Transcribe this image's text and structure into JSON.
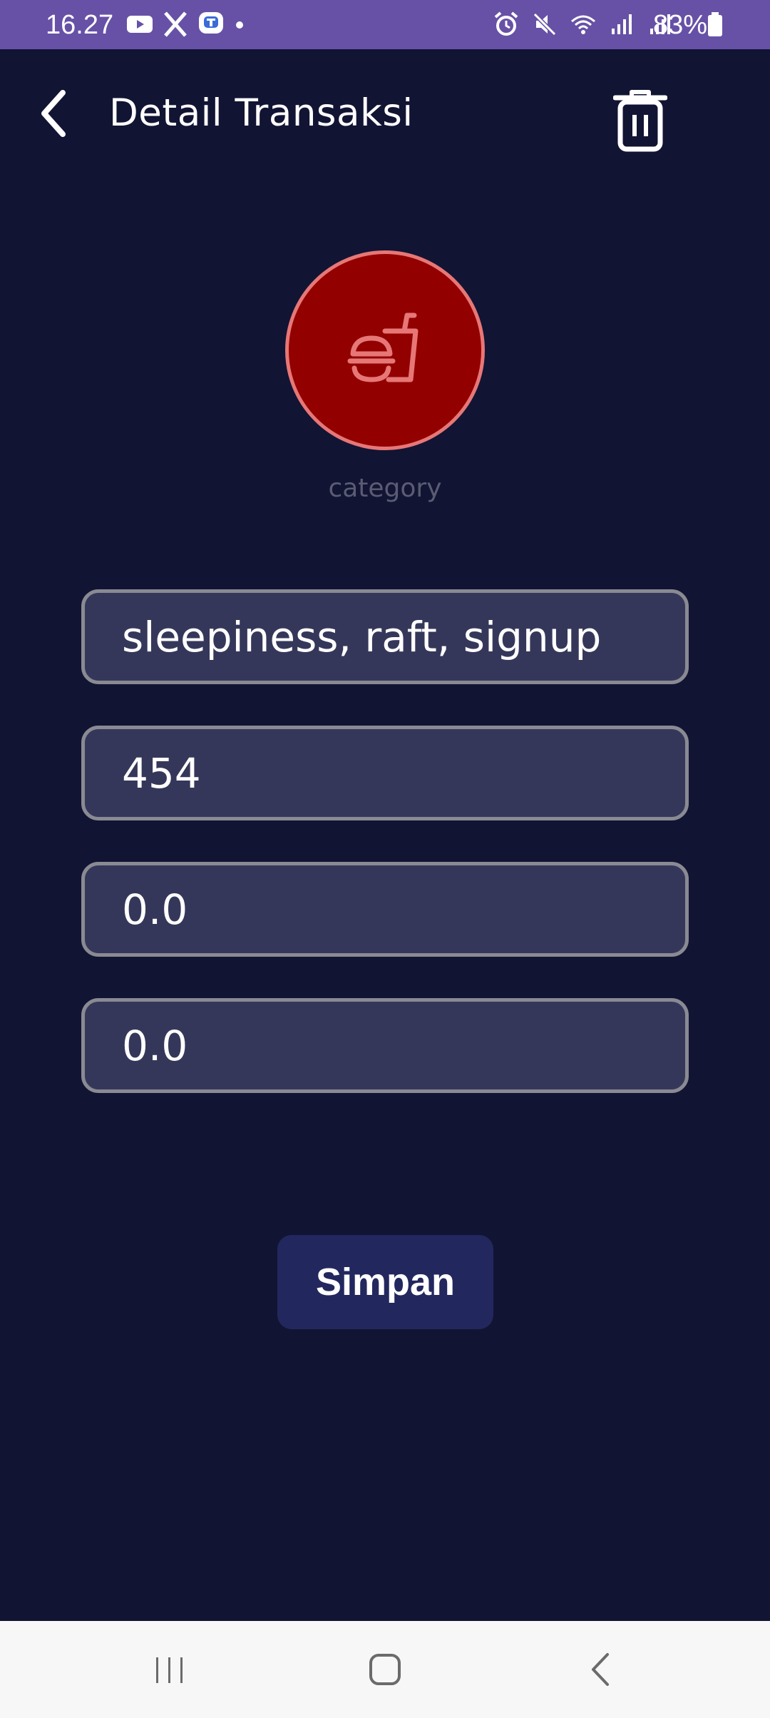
{
  "status_bar": {
    "time": "16.27",
    "battery": "83%",
    "left_icons": [
      "youtube-icon",
      "x-icon",
      "app-icon",
      "dot-icon"
    ],
    "right_icons": [
      "alarm-icon",
      "mute-icon",
      "wifi-icon",
      "signal-icon",
      "signal-icon",
      "battery-icon"
    ]
  },
  "header": {
    "title": "Detail Transaksi",
    "back_icon": "chevron-left-icon",
    "delete_icon": "trash-icon"
  },
  "category": {
    "label": "category",
    "icon": "fast-food-icon",
    "colors": {
      "fill": "#930000",
      "ring": "#e77777",
      "icon": "#e77777"
    }
  },
  "form": {
    "fields": [
      {
        "value": "sleepiness, raft, signup"
      },
      {
        "value": "454"
      },
      {
        "value": "0.0"
      },
      {
        "value": "0.0"
      }
    ],
    "save_label": "Simpan"
  },
  "nav": {
    "recent_icon": "recent-apps-icon",
    "home_icon": "home-icon",
    "back_icon": "back-icon"
  },
  "colors": {
    "background": "#121433",
    "status_bar": "#6751a6",
    "field_bg": "#35375a",
    "field_border": "#8a8a93",
    "button_bg": "#22285e"
  }
}
